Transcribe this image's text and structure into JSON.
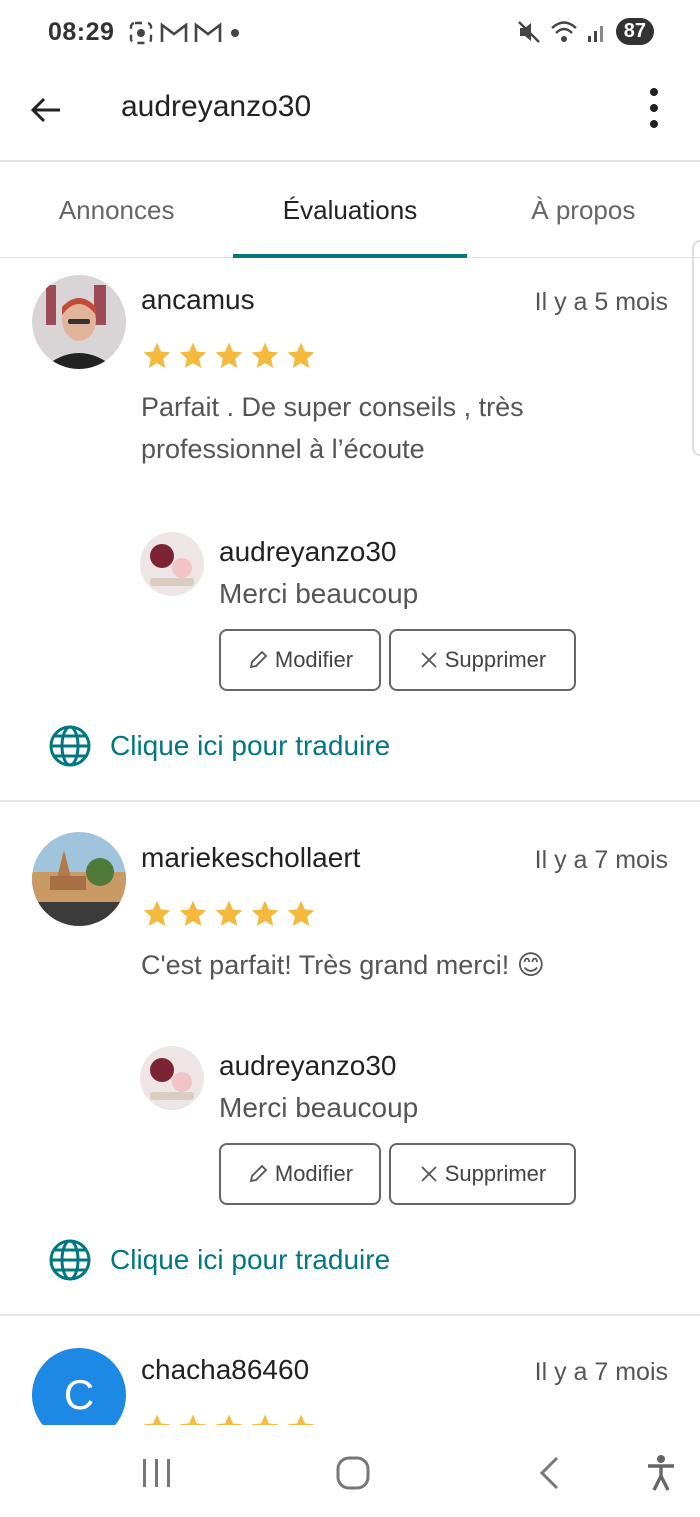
{
  "status_bar": {
    "time": "08:29",
    "battery": "87"
  },
  "header": {
    "title": "audreyanzo30"
  },
  "tabs": [
    {
      "label": "Annonces",
      "active": false
    },
    {
      "label": "Évaluations",
      "active": true
    },
    {
      "label": "À propos",
      "active": false
    }
  ],
  "reviews": [
    {
      "name": "ancamus",
      "date": "Il y a 5 mois",
      "rating": 5,
      "text": "Parfait . De super conseils , très professionnel à l’écoute",
      "reply": {
        "name": "audreyanzo30",
        "text": "Merci beaucoup"
      },
      "edit_label": "Modifier",
      "delete_label": "Supprimer",
      "translate_label": "Clique ici pour traduire"
    },
    {
      "name": "mariekeschollaert",
      "date": "Il y a 7 mois",
      "rating": 5,
      "text": "C'est parfait! Très grand merci! 😊",
      "reply": {
        "name": "audreyanzo30",
        "text": "Merci beaucoup"
      },
      "edit_label": "Modifier",
      "delete_label": "Supprimer",
      "translate_label": "Clique ici pour traduire"
    },
    {
      "name": "chacha86460",
      "date": "Il y a 7 mois",
      "rating": 5,
      "avatar_letter": "C"
    }
  ],
  "colors": {
    "accent": "#007782",
    "star": "#F5B93E",
    "avatar_blue": "#1E88E5"
  }
}
